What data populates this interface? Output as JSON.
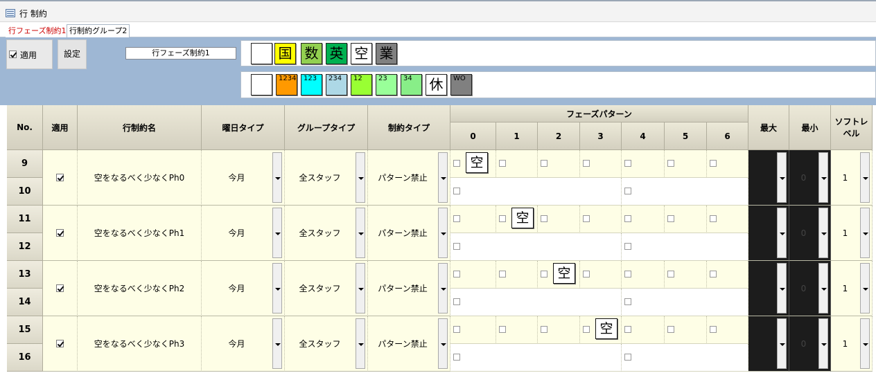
{
  "window": {
    "title": "行 制約"
  },
  "tabs": [
    {
      "label": "行フェーズ制約1",
      "active": true
    },
    {
      "label": "行制約グループ2",
      "active": false
    }
  ],
  "toolbar": {
    "apply_label": "適用",
    "apply_checked": true,
    "settings_label": "設定",
    "name_value": "行フェーズ制約1"
  },
  "palette1": [
    {
      "label": "",
      "color": "#ffffff"
    },
    {
      "label": "国",
      "color": "#ffff00"
    },
    {
      "label": "数",
      "color": "#92d050"
    },
    {
      "label": "英",
      "color": "#00b050"
    },
    {
      "label": "空",
      "color": "#ffffff"
    },
    {
      "label": "業",
      "color": "#808080"
    }
  ],
  "palette2": [
    {
      "label": "",
      "color": "#ffffff"
    },
    {
      "label": "1234",
      "color": "#ff9900"
    },
    {
      "label": "123",
      "color": "#00ffff"
    },
    {
      "label": "234",
      "color": "#add8e6"
    },
    {
      "label": "12",
      "color": "#99ff33"
    },
    {
      "label": "23",
      "color": "#99ff99"
    },
    {
      "label": "34",
      "color": "#88ee88"
    },
    {
      "label": "休",
      "color": "#ffffff"
    },
    {
      "label": "WO",
      "color": "#808080"
    }
  ],
  "grid": {
    "headers": {
      "no": "No.",
      "apply": "適用",
      "name": "行制約名",
      "day_type": "曜日タイプ",
      "group_type": "グループタイプ",
      "constraint_type": "制約タイプ",
      "phase_pattern": "フェーズパターン",
      "phases": [
        "0",
        "1",
        "2",
        "3",
        "4",
        "5",
        "6"
      ],
      "max": "最大",
      "min": "最小",
      "soft_level": "ソフトレベル"
    },
    "rows": [
      {
        "no1": "9",
        "no2": "10",
        "checked": true,
        "name": "空をなるべく少なくPh0",
        "day_type": "今月",
        "group_type": "全スタッフ",
        "constraint_type": "パターン禁止",
        "mark_phase": 0,
        "mark_label": "空",
        "max": "",
        "min": "0",
        "soft_level": "1"
      },
      {
        "no1": "11",
        "no2": "12",
        "checked": true,
        "name": "空をなるべく少なくPh1",
        "day_type": "今月",
        "group_type": "全スタッフ",
        "constraint_type": "パターン禁止",
        "mark_phase": 1,
        "mark_label": "空",
        "max": "",
        "min": "0",
        "soft_level": "1"
      },
      {
        "no1": "13",
        "no2": "14",
        "checked": true,
        "name": "空をなるべく少なくPh2",
        "day_type": "今月",
        "group_type": "全スタッフ",
        "constraint_type": "パターン禁止",
        "mark_phase": 2,
        "mark_label": "空",
        "max": "",
        "min": "0",
        "soft_level": "1"
      },
      {
        "no1": "15",
        "no2": "16",
        "checked": true,
        "name": "空をなるべく少なくPh3",
        "day_type": "今月",
        "group_type": "全スタッフ",
        "constraint_type": "パターン禁止",
        "mark_phase": 3,
        "mark_label": "空",
        "max": "",
        "min": "0",
        "soft_level": "1"
      }
    ]
  }
}
